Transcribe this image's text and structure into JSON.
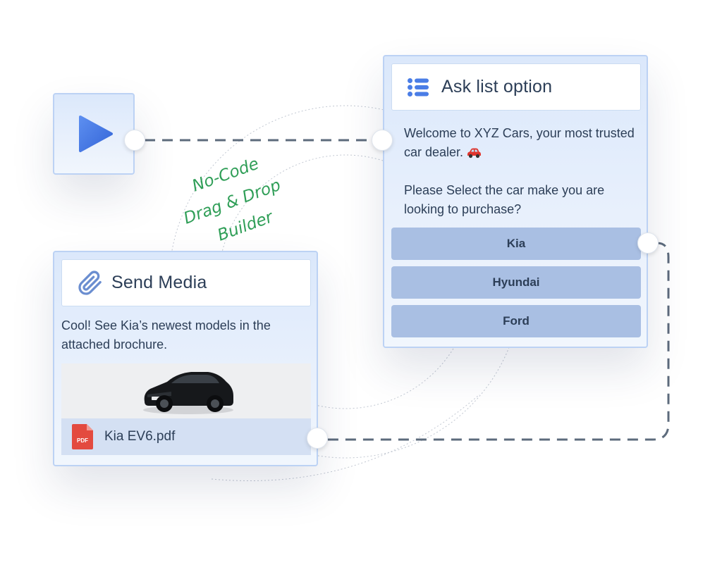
{
  "canvas": {
    "annotation": [
      "No-Code",
      "Drag & Drop",
      "Builder"
    ]
  },
  "start_node": {
    "icon": "play-icon"
  },
  "ask_node": {
    "icon": "list-icon",
    "title": "Ask list option",
    "message_line1": "Welcome to XYZ Cars, your most trusted car dealer.",
    "message_emoji": "car-emoji",
    "message_line2": "Please Select the car make you are looking to purchase?",
    "options": [
      "Kia",
      "Hyundai",
      "Ford"
    ]
  },
  "media_node": {
    "icon": "paperclip-icon",
    "title": "Send Media",
    "message": "Cool! See Kia’s newest models in the attached brochure.",
    "attachment": {
      "icon": "pdf-file-icon",
      "icon_label": "PDF",
      "file_name": "Kia EV6.pdf"
    }
  },
  "colors": {
    "accent": "#4a7de6",
    "card_border": "#bcd2f4",
    "option_fill": "#a9bfe3",
    "connector": "#5d6b7c",
    "annotation": "#2f9e57",
    "pdf": "#e34a3f"
  }
}
